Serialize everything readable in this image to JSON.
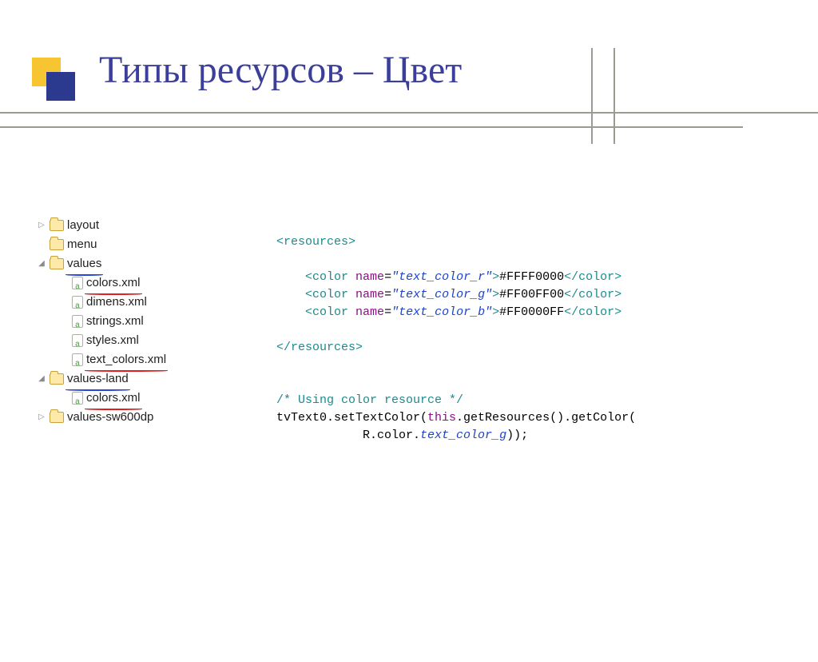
{
  "slide": {
    "title": "Типы ресурсов – Цвет"
  },
  "tree": {
    "items": [
      {
        "kind": "folder",
        "arrow": "▷",
        "indent": 0,
        "label": "layout",
        "underline": ""
      },
      {
        "kind": "folder",
        "arrow": "",
        "indent": 0,
        "label": "menu",
        "underline": ""
      },
      {
        "kind": "folder",
        "arrow": "◢",
        "indent": 0,
        "label": "values",
        "underline": "blue"
      },
      {
        "kind": "file",
        "arrow": "",
        "indent": 1,
        "label": "colors.xml",
        "underline": "red"
      },
      {
        "kind": "file",
        "arrow": "",
        "indent": 1,
        "label": "dimens.xml",
        "underline": ""
      },
      {
        "kind": "file",
        "arrow": "",
        "indent": 1,
        "label": "strings.xml",
        "underline": ""
      },
      {
        "kind": "file",
        "arrow": "",
        "indent": 1,
        "label": "styles.xml",
        "underline": ""
      },
      {
        "kind": "file",
        "arrow": "",
        "indent": 1,
        "label": "text_colors.xml",
        "underline": "red"
      },
      {
        "kind": "folder",
        "arrow": "◢",
        "indent": 0,
        "label": "values-land",
        "underline": "blue"
      },
      {
        "kind": "file",
        "arrow": "",
        "indent": 1,
        "label": "colors.xml",
        "underline": "red"
      },
      {
        "kind": "folder",
        "arrow": "▷",
        "indent": 0,
        "label": "values-sw600dp",
        "underline": ""
      }
    ]
  },
  "xml": {
    "open_resources": "<resources>",
    "close_resources": "</resources>",
    "colors": [
      {
        "name": "text_color_r",
        "value": "#FFFF0000"
      },
      {
        "name": "text_color_g",
        "value": "#FF00FF00"
      },
      {
        "name": "text_color_b",
        "value": "#FF0000FF"
      }
    ]
  },
  "java": {
    "comment": "/* Using color resource */",
    "line1_a": "tvText0.setTextColor(",
    "line1_this": "this",
    "line1_b": ".getResources().getColor(",
    "line2_a": "R.color.",
    "line2_id": "text_color_g",
    "line2_b": "));"
  }
}
